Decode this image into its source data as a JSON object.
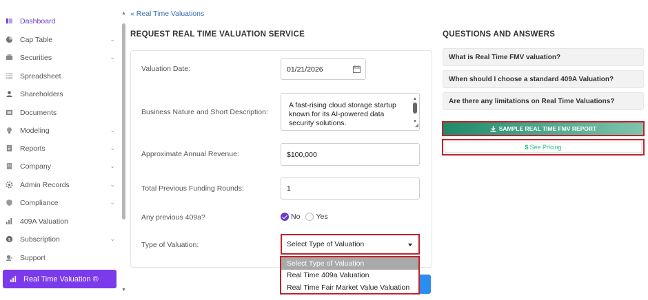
{
  "sidebar": {
    "items": [
      {
        "label": "Dashboard",
        "icon": "dashboard-icon",
        "chevron": false
      },
      {
        "label": "Cap Table",
        "icon": "pie-chart-icon",
        "chevron": true
      },
      {
        "label": "Securities",
        "icon": "securities-icon",
        "chevron": true
      },
      {
        "label": "Spreadsheet",
        "icon": "spreadsheet-icon",
        "chevron": false
      },
      {
        "label": "Shareholders",
        "icon": "user-icon",
        "chevron": false
      },
      {
        "label": "Documents",
        "icon": "document-icon",
        "chevron": false
      },
      {
        "label": "Modeling",
        "icon": "bulb-icon",
        "chevron": true
      },
      {
        "label": "Reports",
        "icon": "report-icon",
        "chevron": true
      },
      {
        "label": "Company",
        "icon": "building-icon",
        "chevron": true
      },
      {
        "label": "Admin Records",
        "icon": "gear-icon",
        "chevron": true
      },
      {
        "label": "Compliance",
        "icon": "shield-icon",
        "chevron": true
      },
      {
        "label": "409A Valuation",
        "icon": "bar-chart-icon",
        "chevron": false
      },
      {
        "label": "Subscription",
        "icon": "coin-icon",
        "chevron": true
      },
      {
        "label": "Support",
        "icon": "support-icon",
        "chevron": false
      }
    ],
    "active": {
      "label": "Real Time Valuation ®",
      "icon": "bar-chart-icon"
    }
  },
  "breadcrumb": {
    "label": "Real Time Valuations"
  },
  "form": {
    "title": "REQUEST REAL TIME VALUATION SERVICE",
    "valuation_date": {
      "label": "Valuation Date:",
      "value": "01/21/2026"
    },
    "business": {
      "label": "Business Nature and Short Description:",
      "value": "A fast-rising cloud storage startup known for its AI-powered data security solutions."
    },
    "revenue": {
      "label": "Approximate Annual Revenue:",
      "value": "$100,000"
    },
    "funding": {
      "label": "Total Previous Funding Rounds:",
      "value": "1"
    },
    "previous_409a": {
      "label": "Any previous 409a?",
      "options": [
        "No",
        "Yes"
      ],
      "selected": "No"
    },
    "type": {
      "label": "Type of Valuation:",
      "value": "Select Type of Valuation",
      "options": [
        "Select Type of Valuation",
        "Real Time 409a Valuation",
        "Real Time Fair Market Value Valuation"
      ]
    }
  },
  "qa": {
    "title": "QUESTIONS AND ANSWERS",
    "items": [
      "What is Real Time FMV valuation?",
      "When should I choose a standard 409A Valuation?",
      "Are there any limitations on Real Time Valuations?"
    ],
    "sample_button": "SAMPLE REAL TIME FMV REPORT",
    "pricing_button": "See Pricing"
  },
  "colors": {
    "accent": "#7c3aed",
    "highlight": "#c0222c",
    "green": "#1f8a6a",
    "pricing_text": "#2bbf86"
  }
}
